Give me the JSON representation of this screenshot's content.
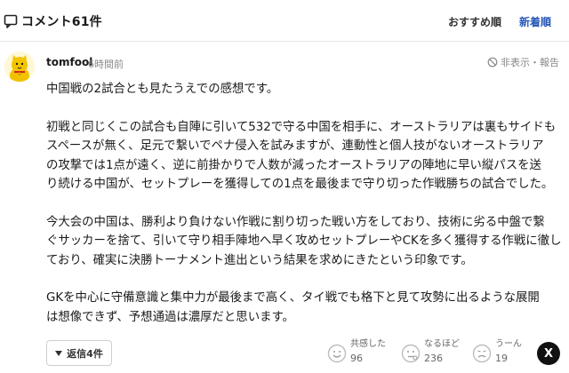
{
  "header": {
    "title": "コメント61件",
    "sort_recommend": "おすすめ順",
    "sort_newest": "新着順"
  },
  "comment": {
    "username": "tomfool",
    "timestamp": "6時間前",
    "hide_report": "非表示・報告",
    "lines": [
      "中国戦の2試合とも見たうえでの感想です。",
      "",
      "初戦と同じくこの試合も自陣に引いて532で守る中国を相手に、オーストラリアは裏もサイドも",
      "スペースが無く、足元で繋いでペナ侵入を試みますが、連動性と個人技がないオーストラリア",
      "の攻撃では1点が遠く、逆に前掛かりで人数が減ったオーストラリアの陣地に早い縦パスを送",
      "り続ける中国が、セットプレーを獲得しての1点を最後まで守り切った作戦勝ちの試合でした。",
      "",
      "今大会の中国は、勝利より負けない作戦に割り切った戦い方をしており、技術に劣る中盤で繋",
      "ぐサッカーを捨て、引いて守り相手陣地へ早く攻めセットプレーやCKを多く獲得する作戦に徹し",
      "ており、確実に決勝トーナメント進出という結果を求めにきたという印象です。",
      "",
      "GKを中心に守備意識と集中力が最後まで高く、タイ戦でも格下と見て攻勢に出るような展開",
      "は想像できず、予想通過は濃厚だと思います。"
    ],
    "reply_label": "返信4件",
    "reactions": [
      {
        "label": "共感した",
        "count": "96"
      },
      {
        "label": "なるほど",
        "count": "236"
      },
      {
        "label": "うーん",
        "count": "19"
      }
    ],
    "share_x": "X"
  },
  "colors": {
    "accent": "#2657b8",
    "muted": "#888888",
    "reaction_face": "#c8c8c8"
  },
  "icons": {
    "comment": "comment-bubble-icon",
    "hide": "ban-icon",
    "reply": "triangle-down-icon",
    "empathy": "smile-face-icon",
    "understand": "thinking-face-icon",
    "hmm": "confused-face-icon",
    "share": "x-logo-icon"
  }
}
